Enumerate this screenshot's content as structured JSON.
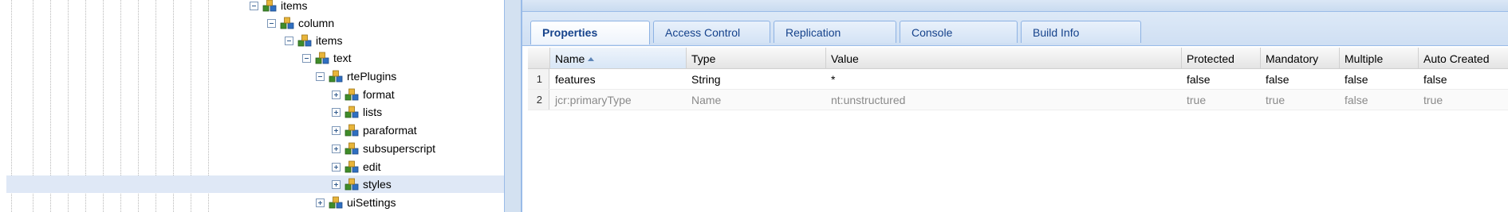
{
  "tree": {
    "nodes": [
      {
        "label": "items",
        "expanded": true,
        "selected": false
      },
      {
        "label": "column",
        "expanded": true,
        "selected": false
      },
      {
        "label": "items",
        "expanded": true,
        "selected": false
      },
      {
        "label": "text",
        "expanded": true,
        "selected": false
      },
      {
        "label": "rtePlugins",
        "expanded": true,
        "selected": false
      },
      {
        "label": "format",
        "expanded": false,
        "selected": false
      },
      {
        "label": "lists",
        "expanded": false,
        "selected": false
      },
      {
        "label": "paraformat",
        "expanded": false,
        "selected": false
      },
      {
        "label": "subsuperscript",
        "expanded": false,
        "selected": false
      },
      {
        "label": "edit",
        "expanded": false,
        "selected": false
      },
      {
        "label": "styles",
        "expanded": false,
        "selected": true
      },
      {
        "label": "uiSettings",
        "expanded": false,
        "selected": false
      }
    ],
    "icon": "node-cubes-icon"
  },
  "tabs": [
    {
      "label": "Properties",
      "active": true
    },
    {
      "label": "Access Control",
      "active": false
    },
    {
      "label": "Replication",
      "active": false
    },
    {
      "label": "Console",
      "active": false
    },
    {
      "label": "Build Info",
      "active": false
    }
  ],
  "grid": {
    "columns": [
      "Name",
      "Type",
      "Value",
      "Protected",
      "Mandatory",
      "Multiple",
      "Auto Created"
    ],
    "sorted_column": "Name",
    "sort_direction": "asc",
    "rows": [
      {
        "num": "1",
        "cells": [
          "features",
          "String",
          "*",
          "false",
          "false",
          "false",
          "false"
        ]
      },
      {
        "num": "2",
        "cells": [
          "jcr:primaryType",
          "Name",
          "nt:unstructured",
          "true",
          "true",
          "false",
          "true"
        ]
      }
    ]
  },
  "colors": {
    "selection": "#dfe8f6",
    "tab_text": "#15428b",
    "panel_border": "#99bbe8"
  }
}
